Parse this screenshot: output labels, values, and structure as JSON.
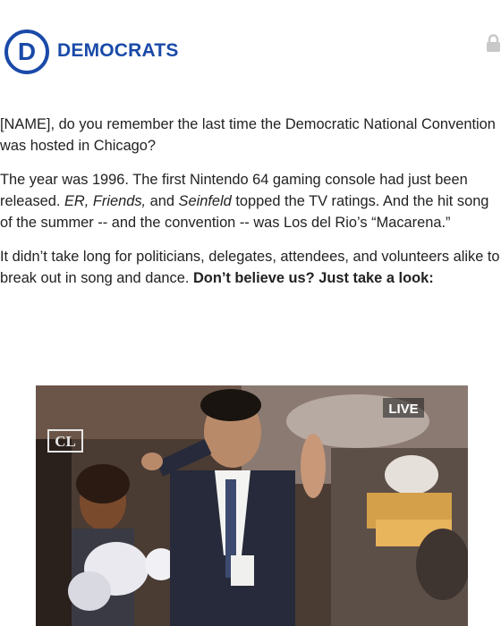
{
  "header": {
    "brand": "DEMOCRATS",
    "logo_letter": "D",
    "brand_color": "#1a4aa8",
    "logo_icon": "democrats-d-logo",
    "lock_icon": "lock-icon"
  },
  "email": {
    "p1": "[NAME], do you remember the last time the Democratic National Convention was hosted in Chicago?",
    "p2": {
      "part1": "The year was 1996. The first Nintendo 64 gaming console had just been released. ",
      "shows_italic": "ER, Friends,",
      "and": " and ",
      "show3_italic": "Seinfeld",
      "part2": " topped the TV ratings. And the hit song of the summer -- and the convention -- was Los del Rio’s “Macarena.”"
    },
    "p3": {
      "text": "It didn’t take long for politicians, delegates, attendees, and volunteers alike to break out in song and dance. ",
      "bold": "Don’t believe us? Just take a look:"
    }
  },
  "media": {
    "live_label": "LIVE",
    "network_logo": "CL"
  }
}
